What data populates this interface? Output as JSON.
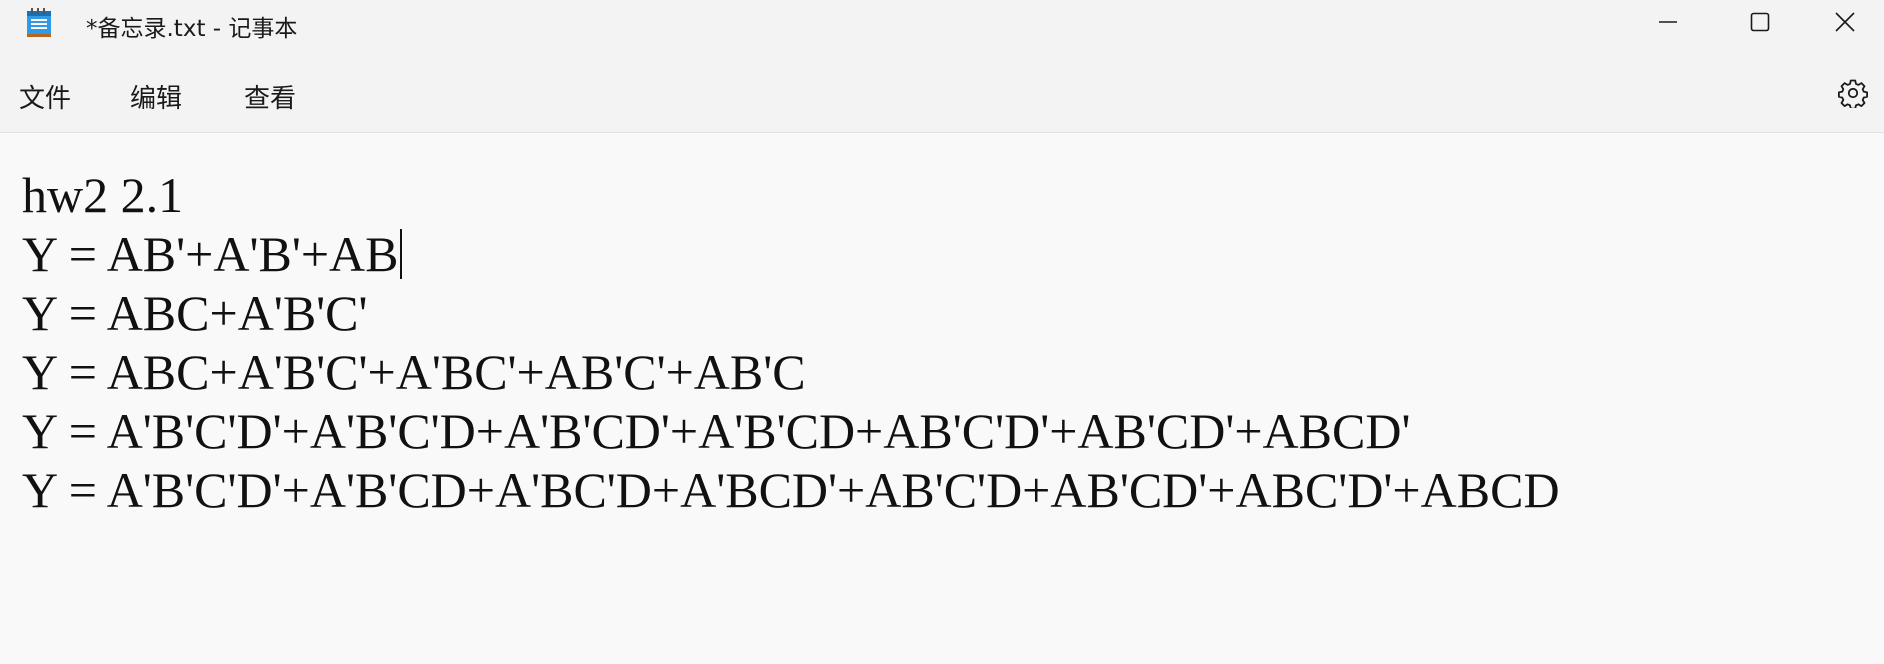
{
  "window": {
    "title": "*备忘录.txt - 记事本",
    "icon": "notepad-icon",
    "controls": [
      "minimize-icon",
      "maximize-icon",
      "close-icon"
    ]
  },
  "menu": {
    "file": "文件",
    "edit": "编辑",
    "view": "查看",
    "settings_icon": "gear-icon"
  },
  "editor": {
    "lines": [
      "hw2 2.1",
      "Y = AB'+A'B'+AB",
      "Y = ABC+A'B'C'",
      "Y = ABC+A'B'C'+A'BC'+AB'C'+AB'C",
      "Y = A'B'C'D'+A'B'C'D+A'B'CD'+A'B'CD+AB'C'D'+AB'CD'+ABCD'",
      "Y = A'B'C'D'+A'B'CD+A'BC'D+A'BCD'+AB'C'D+AB'CD'+ABC'D'+ABCD"
    ],
    "caret_line": 1
  },
  "colors": {
    "titlebar_bg": "#f3f3f3",
    "editor_bg": "#f9f9f9",
    "text": "#111111"
  }
}
